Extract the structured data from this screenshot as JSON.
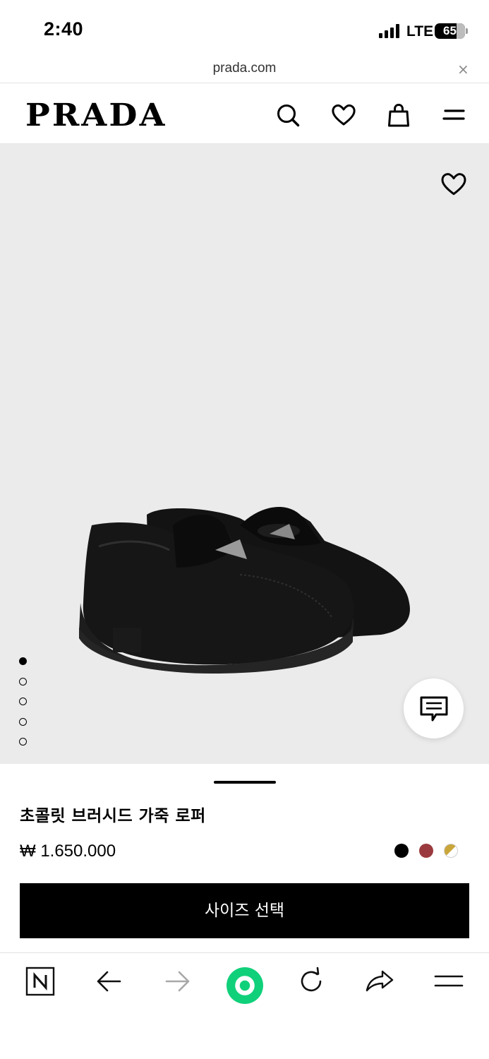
{
  "status": {
    "time": "2:40",
    "network": "LTE",
    "battery": "65"
  },
  "browser": {
    "url": "prada.com",
    "close_glyph": "×"
  },
  "header": {
    "logo": "PRADA",
    "icons": [
      "search-icon",
      "heart-icon",
      "shopping-bag-icon",
      "menu-icon"
    ]
  },
  "gallery": {
    "image_count": 5,
    "active_index": 0
  },
  "product": {
    "name": "초콜릿 브러시드 가죽 로퍼",
    "price": "₩ 1.650.000",
    "colors": [
      "#000000",
      "#9b3a3e",
      "#c9a53a"
    ],
    "size_button": "사이즈 선택"
  },
  "bottom_nav": {
    "icons": [
      "naver-home-icon",
      "back-arrow-icon",
      "forward-arrow-icon",
      "green-dot-icon",
      "reload-icon",
      "share-icon",
      "menu-icon"
    ]
  },
  "colors": {
    "accent_green": "#11d07a"
  }
}
